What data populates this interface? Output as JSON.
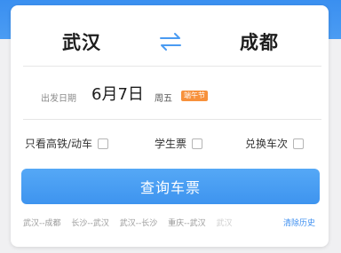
{
  "route": {
    "from": "武汉",
    "to": "成都"
  },
  "date": {
    "label": "出发日期",
    "value": "6月7日",
    "weekday": "周五",
    "holiday_badge": "端午节"
  },
  "options": [
    {
      "label": "只看高铁/动车",
      "checked": false
    },
    {
      "label": "学生票",
      "checked": false
    },
    {
      "label": "兑换车次",
      "checked": false
    }
  ],
  "search_button_label": "查询车票",
  "history": {
    "items": [
      "武汉--成都",
      "长沙--武汉",
      "武汉--长沙",
      "重庆--武汉",
      "武汉"
    ],
    "clear_label": "清除历史"
  },
  "colors": {
    "accent": "#3e94ef",
    "holiday_badge": "#f7913b"
  }
}
